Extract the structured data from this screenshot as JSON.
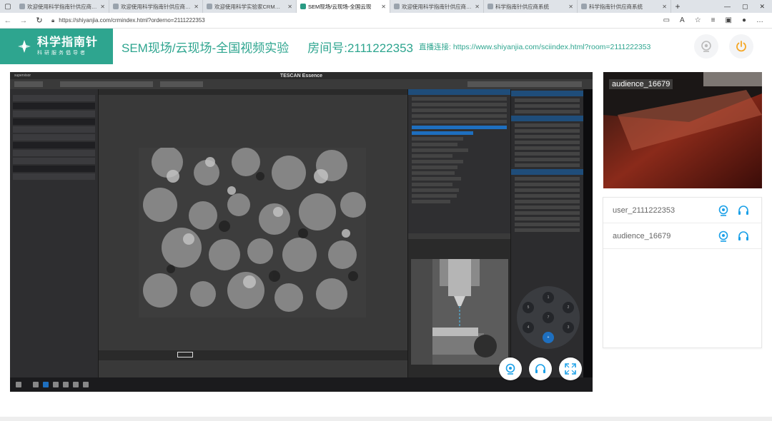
{
  "browser": {
    "tabs": [
      {
        "label": "欢迎使用科学指南针供应商平台",
        "active": false
      },
      {
        "label": "欢迎使用科学指南针供应商平台",
        "active": false
      },
      {
        "label": "欢迎使用科学实验家CRM系统",
        "active": false
      },
      {
        "label": "SEM现场/云现场-全国云现",
        "active": true
      },
      {
        "label": "欢迎使用科学指南针供应商平台",
        "active": false
      },
      {
        "label": "科学指南针供应商系统",
        "active": false
      },
      {
        "label": "科学指南针供应商系统",
        "active": false
      }
    ],
    "url": "https://shiyanjia.com/crmindex.html?orderno=2111222353"
  },
  "header": {
    "logo_name": "科学指南针",
    "logo_sub": "科研服务倡导者",
    "page_title": "SEM现场/云现场-全国视频实验",
    "room_label": "房间号:2111222353",
    "live_link_label": "直播连接:",
    "live_link_url": "https://www.shiyanjia.com/sciindex.html?room=2111222353"
  },
  "stage": {
    "app_name": "TESCAN Essence",
    "app_user": "supervisor"
  },
  "thumbnail": {
    "name": "audience_16679"
  },
  "users": [
    {
      "name": "user_2111222353"
    },
    {
      "name": "audience_16679"
    }
  ],
  "colors": {
    "brand": "#2ea58f",
    "icon_blue": "#1aa0e8"
  }
}
